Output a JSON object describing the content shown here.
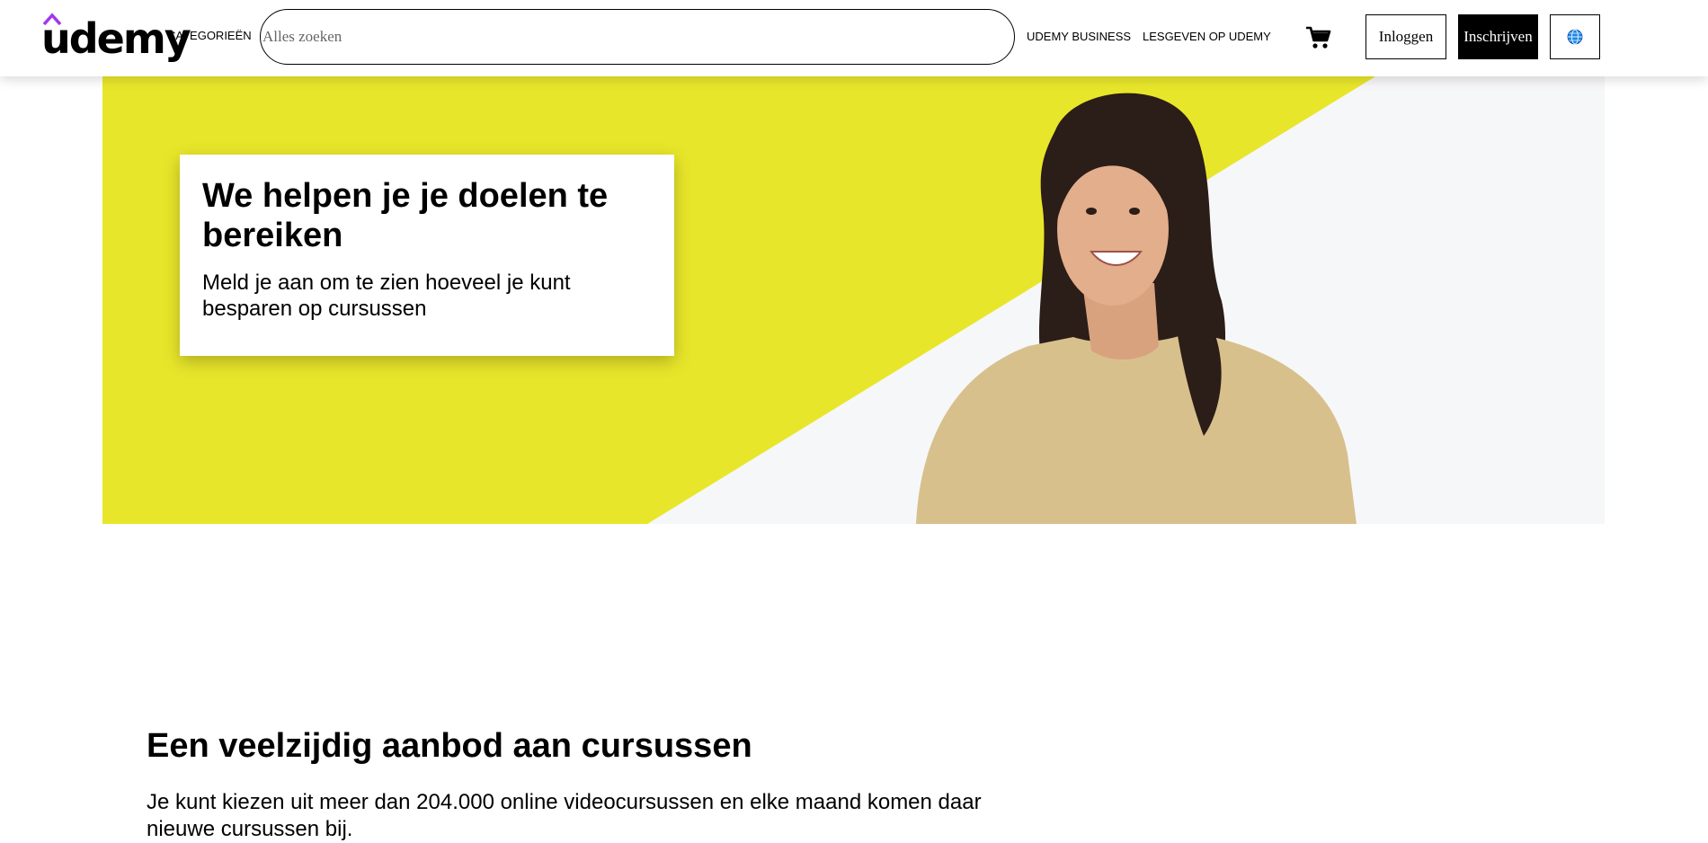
{
  "header": {
    "logo_text": "udemy",
    "categories_label": "CATEGORIEËN",
    "search": {
      "placeholder": "Alles zoeken",
      "value": ""
    },
    "business_label": "UDEMY BUSINESS",
    "teach_label": "LESGEVEN OP UDEMY",
    "cart_icon": "shopping-cart-icon",
    "login_label": "Inloggen",
    "signup_label": "Inschrijven",
    "language_icon": "globe-icon"
  },
  "hero": {
    "title": "We helpen je je doelen te bereiken",
    "subtitle": "Meld je aan om te zien hoeveel je kunt besparen op cursussen",
    "accent_color": "#e8e62a",
    "background_color": "#f6f7f9"
  },
  "section": {
    "title": "Een veelzijdig aanbod aan cursussen",
    "text": "Je kunt kiezen uit meer dan 204.000 online videocursussen en elke maand komen daar nieuwe cursussen bij."
  },
  "colors": {
    "brand_purple": "#a435f0",
    "text": "#000000"
  }
}
